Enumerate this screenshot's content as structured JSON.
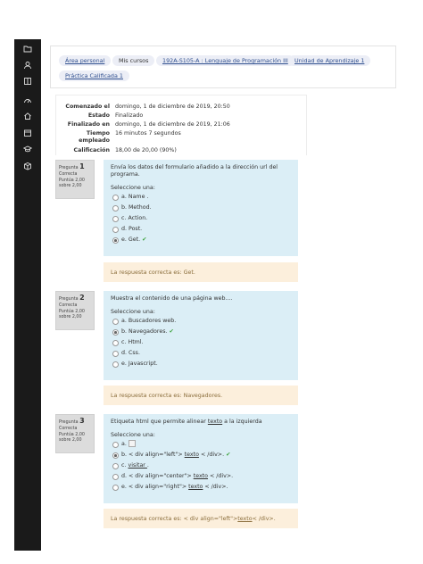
{
  "sidebar": {
    "icons": [
      "folder-icon",
      "user-badge-icon",
      "book-icon",
      "dashboard-icon",
      "home-icon",
      "calendar-icon",
      "graduation-cap-icon",
      "box-icon"
    ]
  },
  "breadcrumb": {
    "items": [
      "Área personal",
      "Mis cursos",
      "192A-S105-A : Lenguaje de Programación III",
      "Unidad de Aprendizaje 1",
      "Práctica Calificada 1"
    ]
  },
  "summary": {
    "rows": [
      {
        "label": "Comenzado el",
        "value": "domingo, 1 de diciembre de 2019, 20:50"
      },
      {
        "label": "Estado",
        "value": "Finalizado"
      },
      {
        "label": "Finalizado en",
        "value": "domingo, 1 de diciembre de 2019, 21:06"
      },
      {
        "label": "Tiempo empleado",
        "value": "16 minutos 7 segundos"
      },
      {
        "label": "Calificación",
        "value": "18,00 de 20,00 (90%)"
      }
    ]
  },
  "questions": [
    {
      "label": "Pregunta",
      "number": "1",
      "status": "Correcta",
      "score": "Puntúa 2,00 sobre 2,00",
      "text": "Envía los datos del formulario añadido a la dirección url del programa.",
      "prompt": "Seleccione una:",
      "options": [
        "a. Name .",
        "b. Method.",
        "c. Action.",
        "d. Post.",
        "e. Get."
      ],
      "selected": 4,
      "feedback": "La respuesta correcta es: Get."
    },
    {
      "label": "Pregunta",
      "number": "2",
      "status": "Correcta",
      "score": "Puntúa 2,00 sobre 2,00",
      "text": "Muestra el contenido de una página web....",
      "prompt": "Seleccione una:",
      "options": [
        "a. Buscadores web.",
        "b. Navegadores.",
        "c. Html.",
        "d. Css.",
        "e. Javascript."
      ],
      "selected": 1,
      "feedback": "La respuesta correcta es: Navegadores."
    },
    {
      "label": "Pregunta",
      "number": "3",
      "status": "Correcta",
      "score": "Puntúa 2,00 sobre 2,00",
      "text_pre": "Etiqueta html que permite alinear ",
      "text_u": "texto",
      "text_post": " a la izquierda",
      "prompt": "Seleccione una:",
      "options": [
        {
          "pre": "a. ",
          "u": "",
          "post": ""
        },
        {
          "pre": "b. < div align=\"left\"> ",
          "u": "texto",
          "post": " < /div>."
        },
        {
          "pre": "c. ",
          "u": "visitar ",
          "post": "."
        },
        {
          "pre": "d. < div align=\"center\"> ",
          "u": "texto",
          "post": " < /div>."
        },
        {
          "pre": "e. < div align=\"right\"> ",
          "u": "texto",
          "post": " < /div>."
        }
      ],
      "selected": 1,
      "feedback_pre": "La respuesta correcta es: < div align=\"left\"> ",
      "feedback_u": "texto",
      "feedback_post": " < /div>."
    }
  ]
}
